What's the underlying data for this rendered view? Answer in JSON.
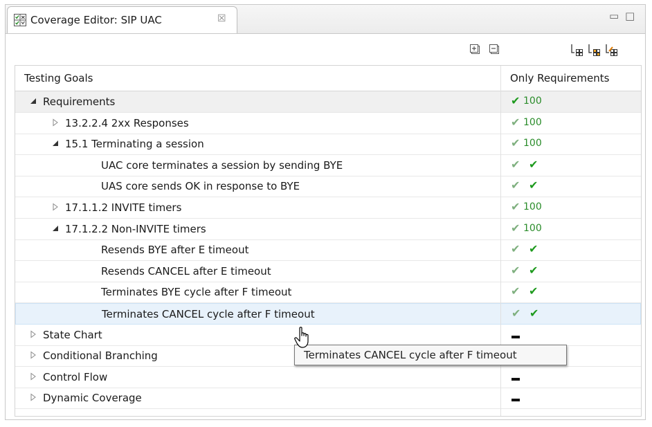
{
  "tab": {
    "icon": "coverage-editor-icon",
    "title": "Coverage Editor: SIP UAC",
    "close_glyph": "☒"
  },
  "view_controls": {
    "minimize": "▭",
    "maximize": "□"
  },
  "toolbar": {
    "buttons": [
      "expand-all-icon",
      "collapse-all-icon",
      "filter-icon",
      "filter-orange-icon",
      "filter-edit-icon"
    ]
  },
  "table": {
    "headers": [
      "Testing Goals",
      "Only Requirements"
    ],
    "rows": [
      {
        "label": "Requirements",
        "level": 0,
        "twisty": "expanded",
        "value": "100",
        "check": "dark",
        "group": true
      },
      {
        "label": "13.2.2.4 2xx Responses",
        "level": 1,
        "twisty": "collapsed",
        "value": "100",
        "check": "light"
      },
      {
        "label": "15.1 Terminating a session",
        "level": 1,
        "twisty": "expanded",
        "value": "100",
        "check": "light"
      },
      {
        "label": "UAC core terminates a session by sending BYE",
        "level": 2,
        "twisty": "none",
        "value": "",
        "check": "double"
      },
      {
        "label": "UAS core sends OK in response to BYE",
        "level": 2,
        "twisty": "none",
        "value": "",
        "check": "double"
      },
      {
        "label": "17.1.1.2 INVITE timers",
        "level": 1,
        "twisty": "collapsed",
        "value": "100",
        "check": "light"
      },
      {
        "label": "17.1.2.2 Non-INVITE timers",
        "level": 1,
        "twisty": "expanded",
        "value": "100",
        "check": "light"
      },
      {
        "label": "Resends BYE after E timeout",
        "level": 2,
        "twisty": "none",
        "value": "",
        "check": "double"
      },
      {
        "label": "Resends CANCEL after E timeout",
        "level": 2,
        "twisty": "none",
        "value": "",
        "check": "double"
      },
      {
        "label": "Terminates BYE cycle after F timeout",
        "level": 2,
        "twisty": "none",
        "value": "",
        "check": "double"
      },
      {
        "label": "Terminates CANCEL cycle after F timeout",
        "level": 2,
        "twisty": "none",
        "value": "",
        "check": "double",
        "hover": true
      },
      {
        "label": "State Chart",
        "level": 0,
        "twisty": "collapsed",
        "value": "",
        "check": "dash"
      },
      {
        "label": "Conditional Branching",
        "level": 0,
        "twisty": "collapsed",
        "value": "",
        "check": "dash"
      },
      {
        "label": "Control Flow",
        "level": 0,
        "twisty": "collapsed",
        "value": "",
        "check": "dash"
      },
      {
        "label": "Dynamic Coverage",
        "level": 0,
        "twisty": "collapsed",
        "value": "",
        "check": "dash"
      }
    ]
  },
  "tooltip": {
    "text": "Terminates CANCEL cycle after F timeout"
  },
  "colors": {
    "check_dark": "#1e9a1e",
    "check_light": "#7fb07f",
    "number": "#2a8c2a",
    "hover_row": "#e8f2fb"
  }
}
